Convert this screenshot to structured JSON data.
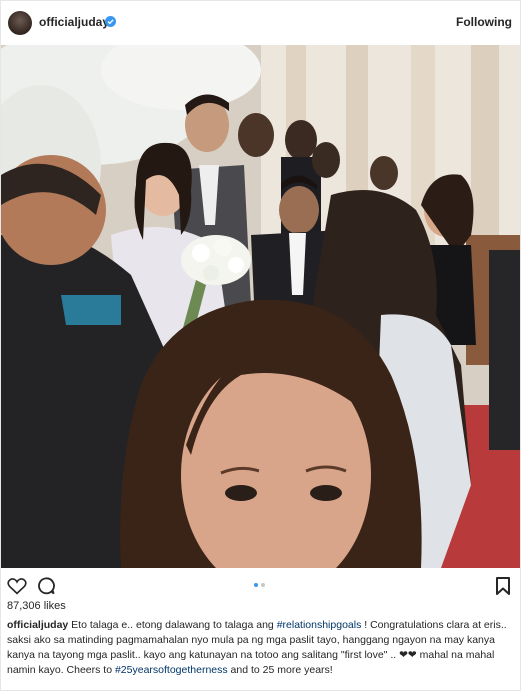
{
  "header": {
    "username": "officialjuday",
    "follow_label": "Following"
  },
  "post": {
    "likes": "87,306 likes",
    "caption_user": "officialjuday",
    "caption_parts": [
      {
        "text": " Eto talaga e.. etong dalawang to talaga ang ",
        "tag": false
      },
      {
        "text": "#relationshipgoals",
        "tag": true
      },
      {
        "text": " ! Congratulations clara at eris.. saksi ako sa matinding pagmamahalan nyo mula pa ng mga paslit tayo, hanggang ngayon na may kanya kanya na tayong mga paslit.. kayo ang katunayan na totoo ang salitang \"first love\" .. ❤❤ mahal na mahal namin kayo. Cheers to ",
        "tag": false
      },
      {
        "text": "#25yearsoftogetherness",
        "tag": true
      },
      {
        "text": " and to 25 more years!",
        "tag": false
      }
    ],
    "carousel": {
      "count": 2,
      "active": 0
    }
  },
  "icons": [
    "avatar",
    "verified-icon",
    "heart-icon",
    "comment-icon",
    "bookmark-icon"
  ],
  "colors": {
    "verified": "#3897f0",
    "hashtag": "#003569",
    "text": "#262626",
    "dot_active": "#3897f0",
    "dot_inactive": "#c7c7c7"
  }
}
